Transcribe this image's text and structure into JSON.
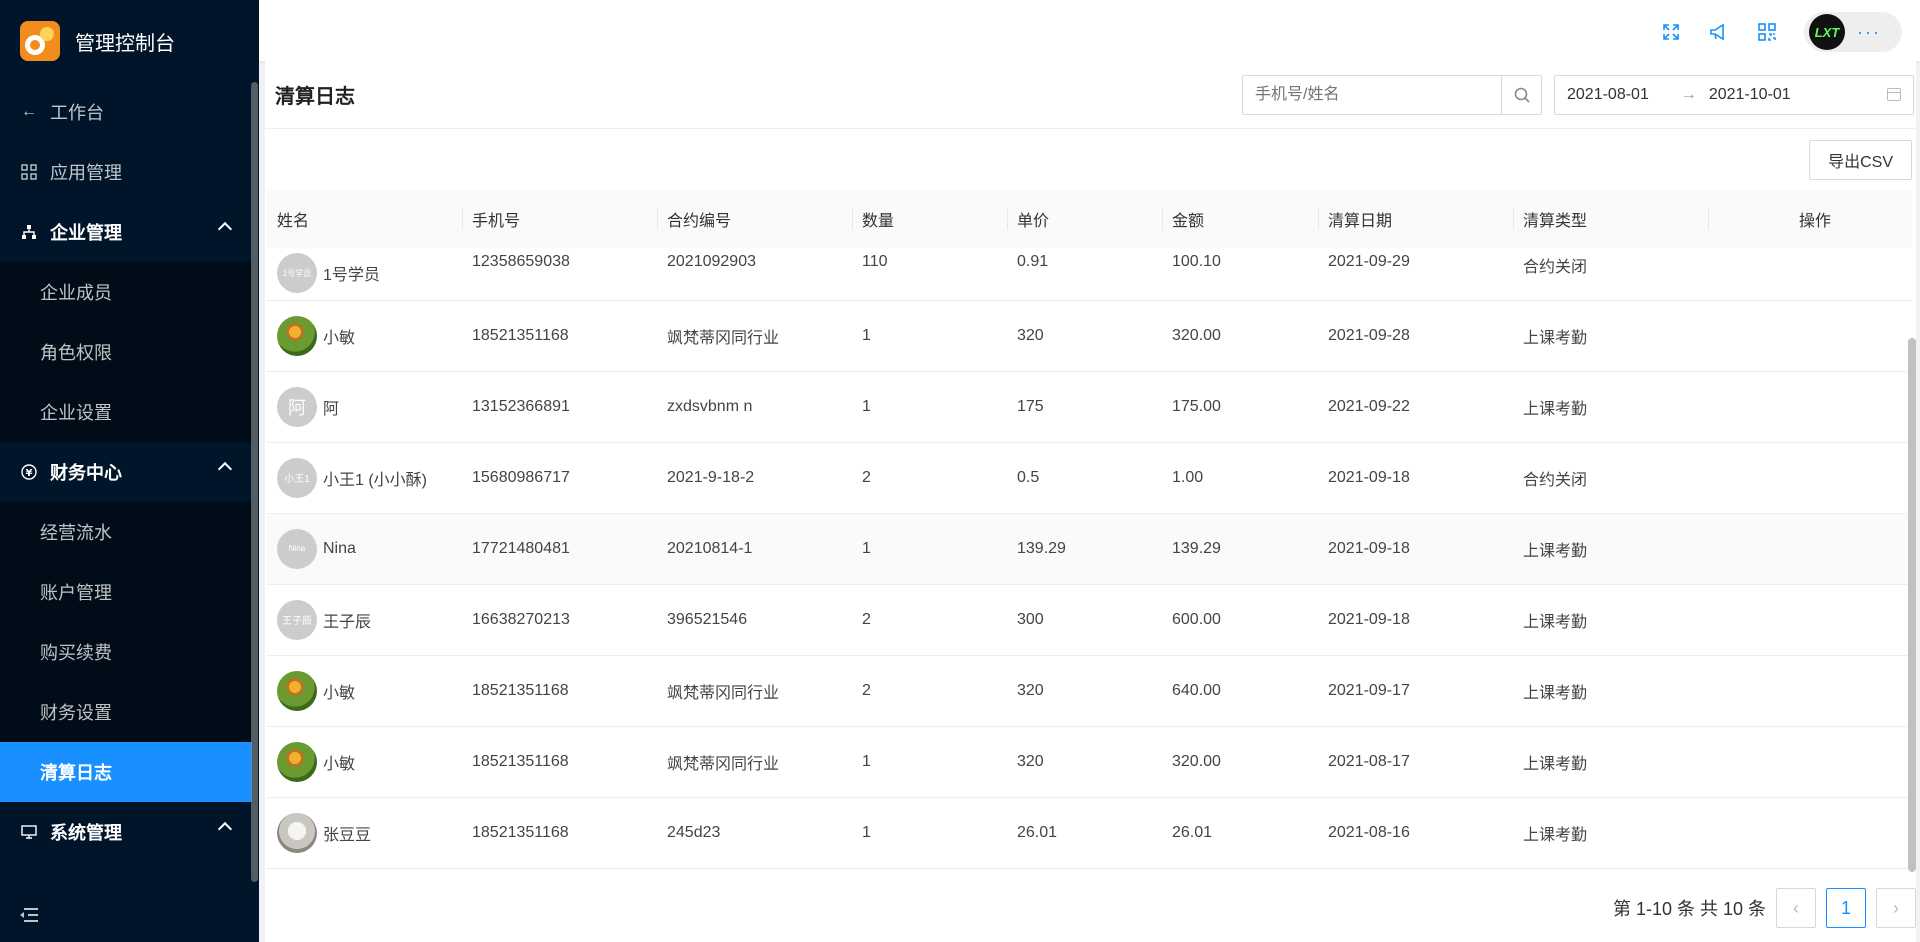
{
  "brand": {
    "title": "管理控制台"
  },
  "sidebar": {
    "back_label": "工作台",
    "app_label": "应用管理",
    "groups": [
      {
        "label": "企业管理",
        "items": [
          "企业成员",
          "角色权限",
          "企业设置"
        ]
      },
      {
        "label": "财务中心",
        "items": [
          "经营流水",
          "账户管理",
          "购买续费",
          "财务设置",
          "清算日志"
        ]
      },
      {
        "label": "系统管理",
        "items": []
      }
    ],
    "active_item": "清算日志"
  },
  "topbar": {
    "icons": [
      "fullscreen-icon",
      "notification-icon",
      "qrcode-icon"
    ],
    "user_badge": "LXT",
    "more": "···"
  },
  "page": {
    "title": "清算日志",
    "search_placeholder": "手机号/姓名",
    "date_start": "2021-08-01",
    "date_arrow": "→",
    "date_end": "2021-10-01",
    "export_label": "导出CSV"
  },
  "table": {
    "columns": [
      "姓名",
      "手机号",
      "合约编号",
      "数量",
      "单价",
      "金额",
      "清算日期",
      "清算类型",
      "操作"
    ],
    "rows": [
      {
        "avatar": "1号学员",
        "avatar_type": "text",
        "name": "1号学员",
        "phone": "12358659038",
        "contract": "2021092903",
        "qty": "110",
        "price": "0.91",
        "amount": "100.10",
        "date": "2021-09-29",
        "type": "合约关闭"
      },
      {
        "avatar": "",
        "avatar_type": "img-green",
        "name": "小敏",
        "phone": "18521351168",
        "contract": "飒梵蒂冈同行业",
        "qty": "1",
        "price": "320",
        "amount": "320.00",
        "date": "2021-09-28",
        "type": "上课考勤"
      },
      {
        "avatar": "阿",
        "avatar_type": "big",
        "name": "阿",
        "phone": "13152366891",
        "contract": "zxdsvbnm n",
        "qty": "1",
        "price": "175",
        "amount": "175.00",
        "date": "2021-09-22",
        "type": "上课考勤"
      },
      {
        "avatar": "小王1",
        "avatar_type": "text",
        "name": "小王1 (小小酥)",
        "phone": "15680986717",
        "contract": "2021-9-18-2",
        "qty": "2",
        "price": "0.5",
        "amount": "1.00",
        "date": "2021-09-18",
        "type": "合约关闭"
      },
      {
        "avatar": "Nina",
        "avatar_type": "text",
        "name": "Nina",
        "phone": "17721480481",
        "contract": "20210814-1",
        "qty": "1",
        "price": "139.29",
        "amount": "139.29",
        "date": "2021-09-18",
        "type": "上课考勤"
      },
      {
        "avatar": "王子辰",
        "avatar_type": "text",
        "name": "王子辰",
        "phone": "16638270213",
        "contract": "396521546",
        "qty": "2",
        "price": "300",
        "amount": "600.00",
        "date": "2021-09-18",
        "type": "上课考勤"
      },
      {
        "avatar": "",
        "avatar_type": "img-green",
        "name": "小敏",
        "phone": "18521351168",
        "contract": "飒梵蒂冈同行业",
        "qty": "2",
        "price": "320",
        "amount": "640.00",
        "date": "2021-09-17",
        "type": "上课考勤"
      },
      {
        "avatar": "",
        "avatar_type": "img-green",
        "name": "小敏",
        "phone": "18521351168",
        "contract": "飒梵蒂冈同行业",
        "qty": "1",
        "price": "320",
        "amount": "320.00",
        "date": "2021-08-17",
        "type": "上课考勤"
      },
      {
        "avatar": "",
        "avatar_type": "img-gray",
        "name": "张豆豆",
        "phone": "18521351168",
        "contract": "245d23",
        "qty": "1",
        "price": "26.01",
        "amount": "26.01",
        "date": "2021-08-16",
        "type": "上课考勤"
      }
    ]
  },
  "pagination": {
    "summary": "第 1-10 条 共 10 条",
    "current": "1",
    "prev": "‹",
    "next": "›"
  }
}
